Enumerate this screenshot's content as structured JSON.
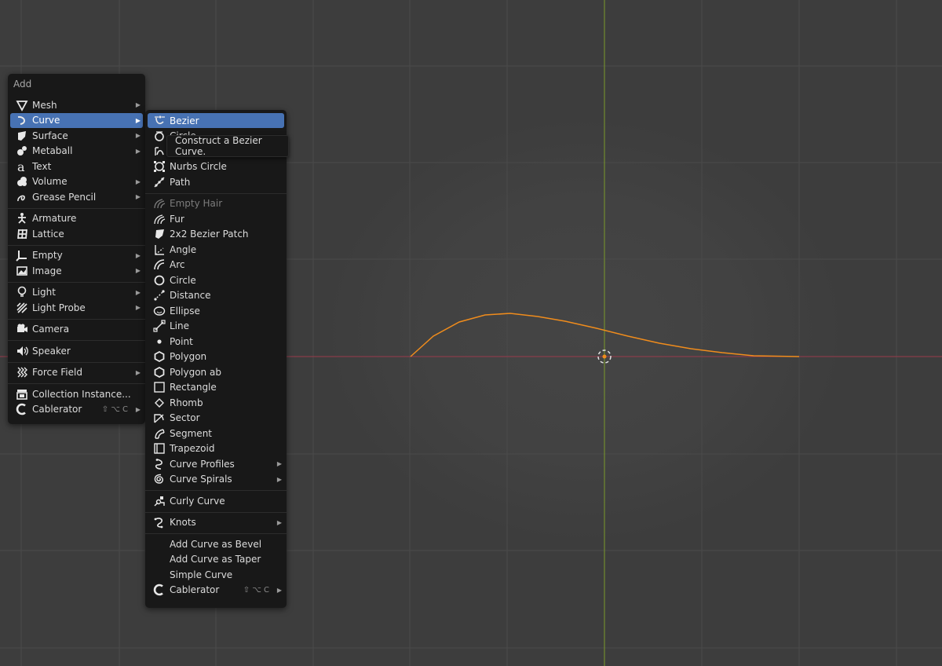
{
  "add_menu": {
    "title": "Add",
    "items": [
      {
        "label": "Mesh",
        "icon": "mesh-icon",
        "submenu": true
      },
      {
        "label": "Curve",
        "icon": "curve-icon",
        "submenu": true,
        "active": true
      },
      {
        "label": "Surface",
        "icon": "surface-icon",
        "submenu": true
      },
      {
        "label": "Metaball",
        "icon": "metaball-icon",
        "submenu": true
      },
      {
        "label": "Text",
        "icon": "text-icon"
      },
      {
        "label": "Volume",
        "icon": "volume-icon",
        "submenu": true
      },
      {
        "label": "Grease Pencil",
        "icon": "grease-pencil-icon",
        "submenu": true
      },
      {
        "label": "Armature",
        "icon": "armature-icon"
      },
      {
        "label": "Lattice",
        "icon": "lattice-icon"
      },
      {
        "label": "Empty",
        "icon": "empty-icon",
        "submenu": true
      },
      {
        "label": "Image",
        "icon": "image-icon",
        "submenu": true
      },
      {
        "label": "Light",
        "icon": "light-icon",
        "submenu": true
      },
      {
        "label": "Light Probe",
        "icon": "light-probe-icon",
        "submenu": true
      },
      {
        "label": "Camera",
        "icon": "camera-icon"
      },
      {
        "label": "Speaker",
        "icon": "speaker-icon"
      },
      {
        "label": "Force Field",
        "icon": "force-field-icon",
        "submenu": true
      },
      {
        "label": "Collection Instance...",
        "icon": "collection-instance-icon"
      },
      {
        "label": "Cablerator",
        "icon": "cablerator-icon",
        "shortcut": "⇧ ⌥ C",
        "submenu": true
      }
    ]
  },
  "curve_menu": {
    "items": [
      {
        "label": "Bezier",
        "icon": "bezier-icon",
        "active": true
      },
      {
        "label": "Circle",
        "icon": "bezier-circle-icon"
      },
      {
        "label": "Nurbs Curve",
        "icon": "nurbs-curve-icon"
      },
      {
        "label": "Nurbs Circle",
        "icon": "nurbs-circle-icon"
      },
      {
        "label": "Path",
        "icon": "path-icon"
      },
      {
        "label": "Empty Hair",
        "icon": "empty-hair-icon",
        "disabled": true
      },
      {
        "label": "Fur",
        "icon": "fur-icon"
      },
      {
        "label": "2x2 Bezier Patch",
        "icon": "bezier-patch-icon"
      },
      {
        "label": "Angle",
        "icon": "angle-icon"
      },
      {
        "label": "Arc",
        "icon": "arc-icon"
      },
      {
        "label": "Circle",
        "icon": "circle-icon"
      },
      {
        "label": "Distance",
        "icon": "distance-icon"
      },
      {
        "label": "Ellipse",
        "icon": "ellipse-icon"
      },
      {
        "label": "Line",
        "icon": "line-icon"
      },
      {
        "label": "Point",
        "icon": "point-icon"
      },
      {
        "label": "Polygon",
        "icon": "polygon-icon"
      },
      {
        "label": "Polygon ab",
        "icon": "polygon-ab-icon"
      },
      {
        "label": "Rectangle",
        "icon": "rectangle-icon"
      },
      {
        "label": "Rhomb",
        "icon": "rhomb-icon"
      },
      {
        "label": "Sector",
        "icon": "sector-icon"
      },
      {
        "label": "Segment",
        "icon": "segment-icon"
      },
      {
        "label": "Trapezoid",
        "icon": "trapezoid-icon"
      },
      {
        "label": "Curve Profiles",
        "icon": "curve-profiles-icon",
        "submenu": true
      },
      {
        "label": "Curve Spirals",
        "icon": "curve-spirals-icon",
        "submenu": true
      },
      {
        "label": "Curly Curve",
        "icon": "curly-curve-icon"
      },
      {
        "label": "Knots",
        "icon": "knots-icon",
        "submenu": true
      },
      {
        "label": "Add Curve as Bevel",
        "icon": ""
      },
      {
        "label": "Add Curve as Taper",
        "icon": ""
      },
      {
        "label": "Simple Curve",
        "icon": ""
      },
      {
        "label": "Cablerator",
        "icon": "cablerator-icon",
        "shortcut": "⇧ ⌥ C",
        "submenu": true
      }
    ]
  },
  "tooltip": {
    "text": "Construct a Bezier Curve."
  },
  "colors": {
    "viewport_bg": "#3d3d3d",
    "grid_line": "#4a4a4a",
    "x_axis": "#9a3a4c",
    "y_axis": "#7a9a2a",
    "curve": "#f08c1c",
    "menu_bg": "#181818",
    "highlight": "#4772b3"
  }
}
